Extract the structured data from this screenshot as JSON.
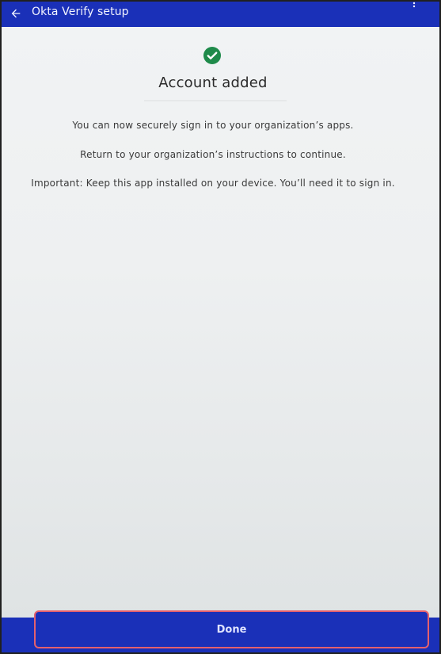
{
  "header": {
    "title": "Okta Verify setup",
    "back_icon": "arrow-left-icon",
    "menu_icon": "more-vertical-icon"
  },
  "main": {
    "status_icon": "check-circle-icon",
    "heading": "Account added",
    "messages": [
      "You can now securely sign in to your organization’s apps.",
      "Return to your organization’s instructions to continue.",
      "Important: Keep this app installed on your device. You’ll need it to sign in."
    ]
  },
  "footer": {
    "done_label": "Done"
  },
  "colors": {
    "brand": "#1a30b8",
    "success": "#1e8a4a",
    "highlight": "#e4606d"
  }
}
